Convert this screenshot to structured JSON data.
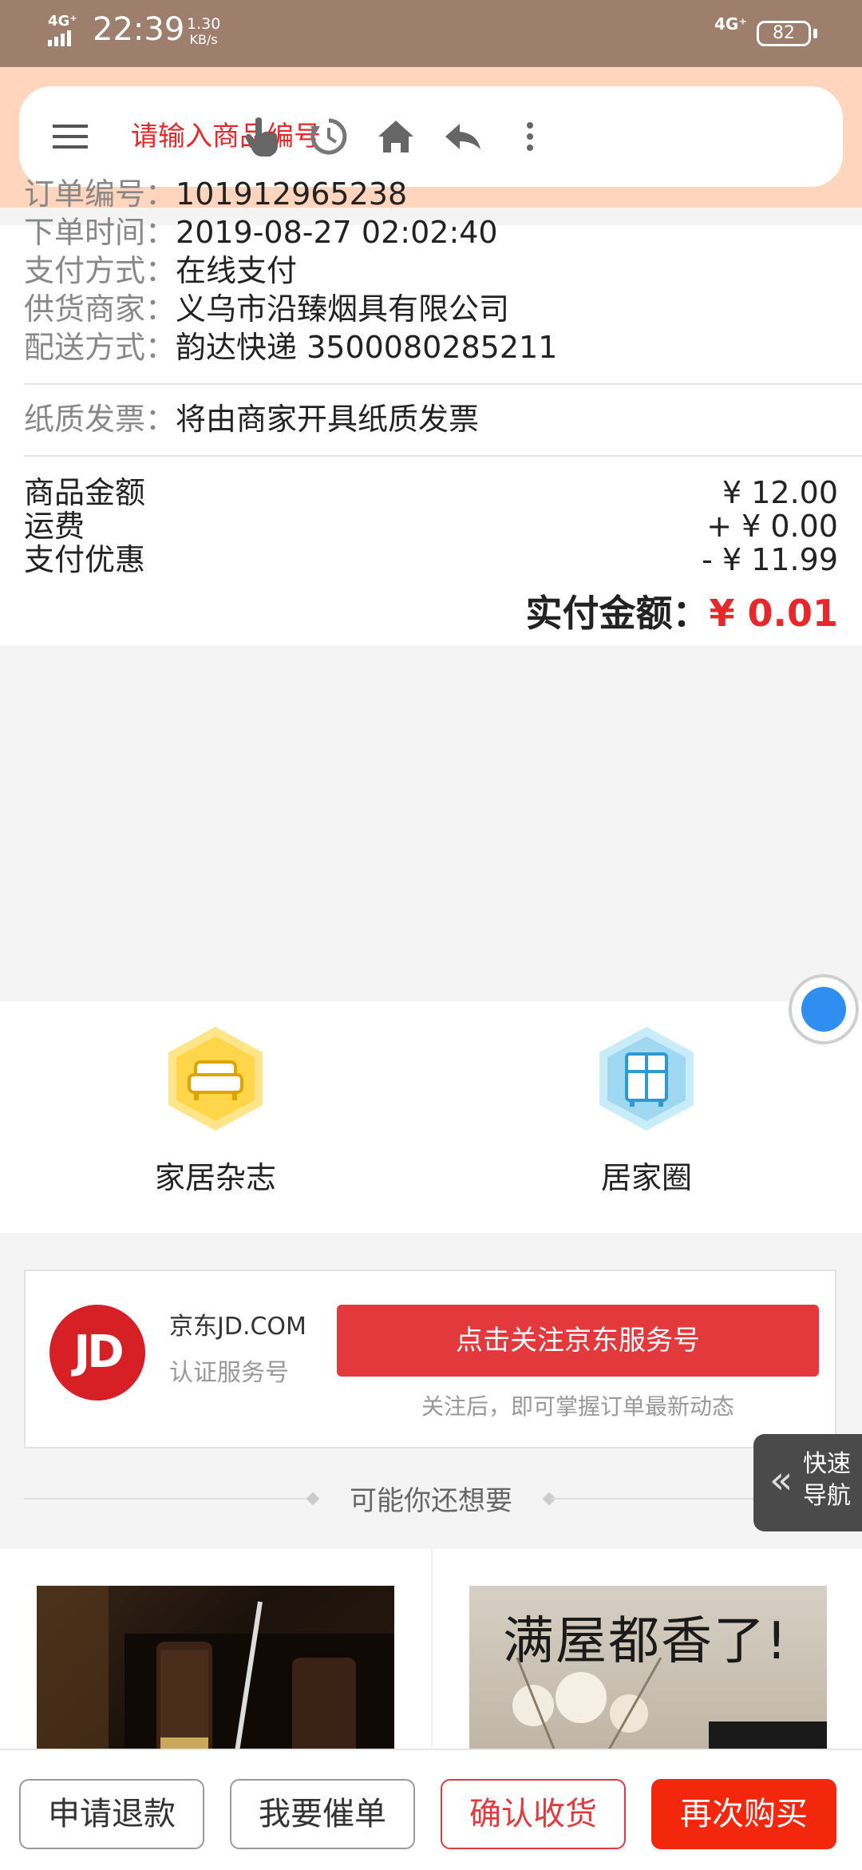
{
  "status_bar": {
    "network_left": "4G⁺",
    "time": "22:39",
    "speed_value": "1.30",
    "speed_unit": "KB/s",
    "network_right": "4G⁺",
    "battery": "82"
  },
  "top_nav": {
    "search_placeholder": "请输入商品编号",
    "icons": [
      "menu-icon",
      "hand-pointer-icon",
      "history-icon",
      "home-icon",
      "reply-icon",
      "more-icon"
    ]
  },
  "order_info": {
    "rows": [
      {
        "label": "订单编号：",
        "value": "101912965238"
      },
      {
        "label": "下单时间：",
        "value": "2019-08-27 02:02:40"
      },
      {
        "label": "支付方式：",
        "value": "在线支付"
      },
      {
        "label": "供货商家：",
        "value": "义乌市沿臻烟具有限公司"
      },
      {
        "label": "配送方式：",
        "value": "韵达快递 3500080285211"
      }
    ],
    "invoice": {
      "label": "纸质发票：",
      "value": "将由商家开具纸质发票"
    }
  },
  "amounts": {
    "rows": [
      {
        "label": "商品金额",
        "value": "¥ 12.00"
      },
      {
        "label": "运费",
        "value": "+ ¥ 0.00"
      },
      {
        "label": "支付优惠",
        "value": "- ¥ 11.99"
      }
    ],
    "total_label": "实付金额：",
    "total_value": "¥ 0.01"
  },
  "home_links": [
    {
      "label": "家居杂志",
      "icon": "sofa-icon",
      "color": "#ffd54a"
    },
    {
      "label": "居家圈",
      "icon": "cabinet-icon",
      "color": "#9fd8f0"
    }
  ],
  "jd_card": {
    "logo_text": "JD",
    "name": "京东JD.COM",
    "subtitle": "认证服务号",
    "follow_button": "点击关注京东服务号",
    "tip": "关注后，即可掌握订单最新动态"
  },
  "quick_nav": {
    "label_line1": "快速",
    "label_line2": "导航"
  },
  "recommend": {
    "title": "可能你还想要",
    "product2_text": "满屋都香了!"
  },
  "bottom_bar": {
    "refund": "申请退款",
    "urge": "我要催单",
    "confirm": "确认收货",
    "rebuy": "再次购买"
  },
  "colors": {
    "accent": "#e4393c",
    "price": "#e8272a",
    "statusbar": "#9e7e6d",
    "navbar_bg": "#ffd5be"
  }
}
